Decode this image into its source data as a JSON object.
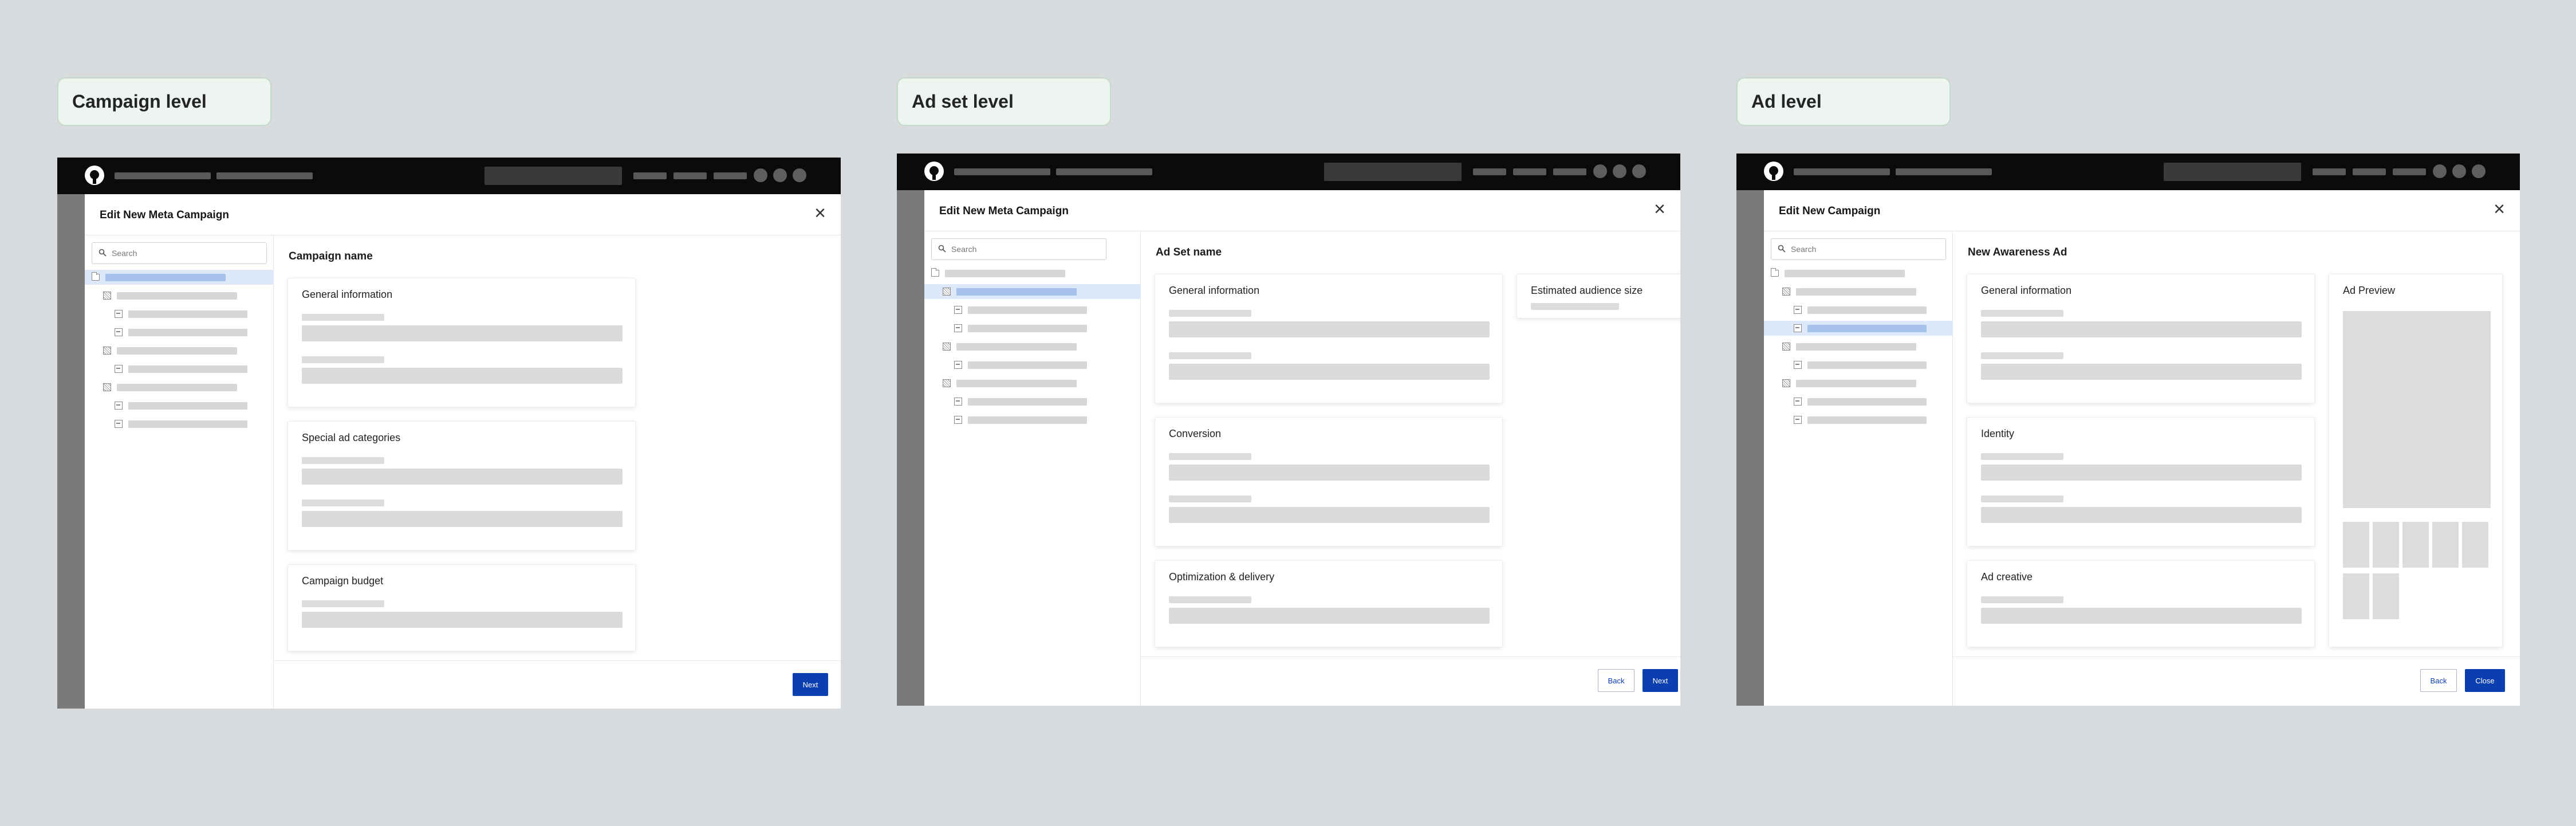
{
  "panels": [
    {
      "level_label": "Campaign level",
      "dialog_title": "Edit New Meta Campaign",
      "main_title": "Campaign name",
      "search_placeholder": "Search",
      "cards": {
        "c1": "General information",
        "c2": "Special ad categories",
        "c3": "Campaign budget"
      },
      "buttons": {
        "next": "Next"
      },
      "close_glyph": "×"
    },
    {
      "level_label": "Ad set level",
      "dialog_title": "Edit New Meta Campaign",
      "main_title": "Ad Set name",
      "search_placeholder": "Search",
      "cards": {
        "c1": "General information",
        "c2": "Conversion",
        "c3": "Optimization & delivery",
        "side": "Estimated audience size"
      },
      "buttons": {
        "back": "Back",
        "next": "Next"
      },
      "close_glyph": "×"
    },
    {
      "level_label": "Ad level",
      "dialog_title": "Edit New Campaign",
      "main_title": "New Awareness Ad",
      "search_placeholder": "Search",
      "cards": {
        "c1": "General information",
        "c2": "Identity",
        "c3": "Ad creative",
        "side": "Ad Preview"
      },
      "buttons": {
        "back": "Back",
        "close": "Close"
      },
      "close_glyph": "×"
    }
  ],
  "colors": {
    "page_background": "#d8dbde",
    "label_background": "#eef5f0",
    "top_bar": "#0b0b0b",
    "primary_button": "#0b3fb0",
    "tree_selection": "#dde8f8",
    "tree_highlight_bar": "#a6c1ea",
    "skeleton": "#d8d8d8"
  },
  "icons": [
    "logo-icon",
    "close-icon",
    "search-icon",
    "folder-icon",
    "ad-set-icon",
    "ad-icon"
  ],
  "tree_selected_index": [
    0,
    1,
    2
  ]
}
